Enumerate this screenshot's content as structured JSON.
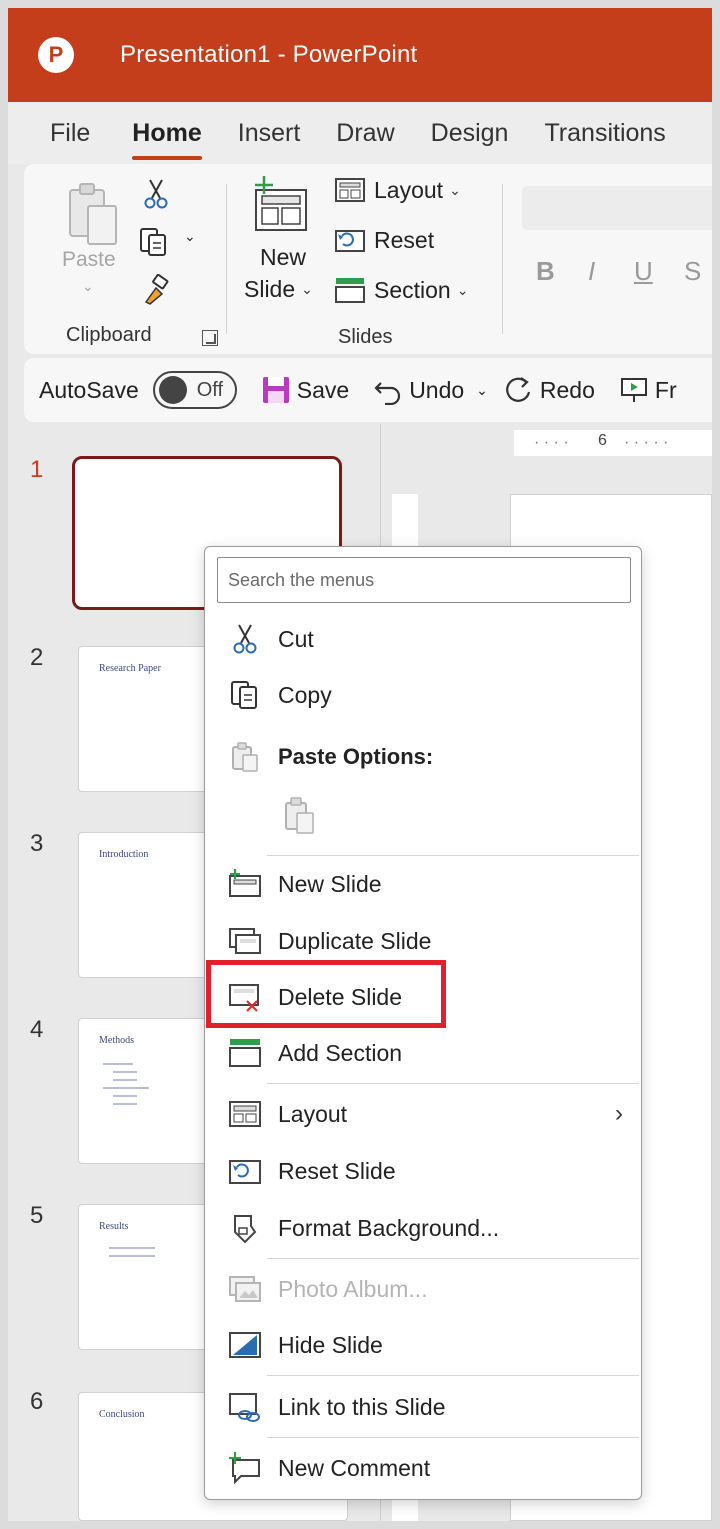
{
  "window": {
    "title": "Presentation1  -  PowerPoint",
    "app_letter": "P"
  },
  "tabs": [
    {
      "label": "File"
    },
    {
      "label": "Home"
    },
    {
      "label": "Insert"
    },
    {
      "label": "Draw"
    },
    {
      "label": "Design"
    },
    {
      "label": "Transitions"
    }
  ],
  "ribbon": {
    "clipboard": {
      "paste_label": "Paste",
      "group_label": "Clipboard"
    },
    "slides": {
      "new_slide_line1": "New",
      "new_slide_line2": "Slide",
      "layout_label": "Layout",
      "reset_label": "Reset",
      "section_label": "Section",
      "group_label": "Slides"
    },
    "font": {
      "bold": "B",
      "italic": "I",
      "underline": "U",
      "strike": "S"
    }
  },
  "qat": {
    "autosave_label": "AutoSave",
    "toggle_state": "Off",
    "save_label": "Save",
    "undo_label": "Undo",
    "redo_label": "Redo",
    "present_label": "Fr"
  },
  "ruler": {
    "mark": "6"
  },
  "slides": [
    {
      "number": "1",
      "title": ""
    },
    {
      "number": "2",
      "title": "Research Paper"
    },
    {
      "number": "3",
      "title": "Introduction"
    },
    {
      "number": "4",
      "title": "Methods"
    },
    {
      "number": "5",
      "title": "Results"
    },
    {
      "number": "6",
      "title": "Conclusion"
    }
  ],
  "context_menu": {
    "search_placeholder": "Search the menus",
    "items": {
      "cut": "Cut",
      "copy": "Copy",
      "paste_options": "Paste Options:",
      "new_slide": "New Slide",
      "duplicate_slide": "Duplicate Slide",
      "delete_slide": "Delete Slide",
      "add_section": "Add Section",
      "layout": "Layout",
      "reset_slide": "Reset Slide",
      "format_background": "Format Background...",
      "photo_album": "Photo Album...",
      "hide_slide": "Hide Slide",
      "link_slide": "Link to this Slide",
      "new_comment": "New Comment"
    },
    "highlighted_item": "Delete Slide",
    "highlight_color": "#e0202a"
  },
  "colors": {
    "accent": "#c43e1c",
    "selected_thumb_border": "#7b1a1a"
  }
}
